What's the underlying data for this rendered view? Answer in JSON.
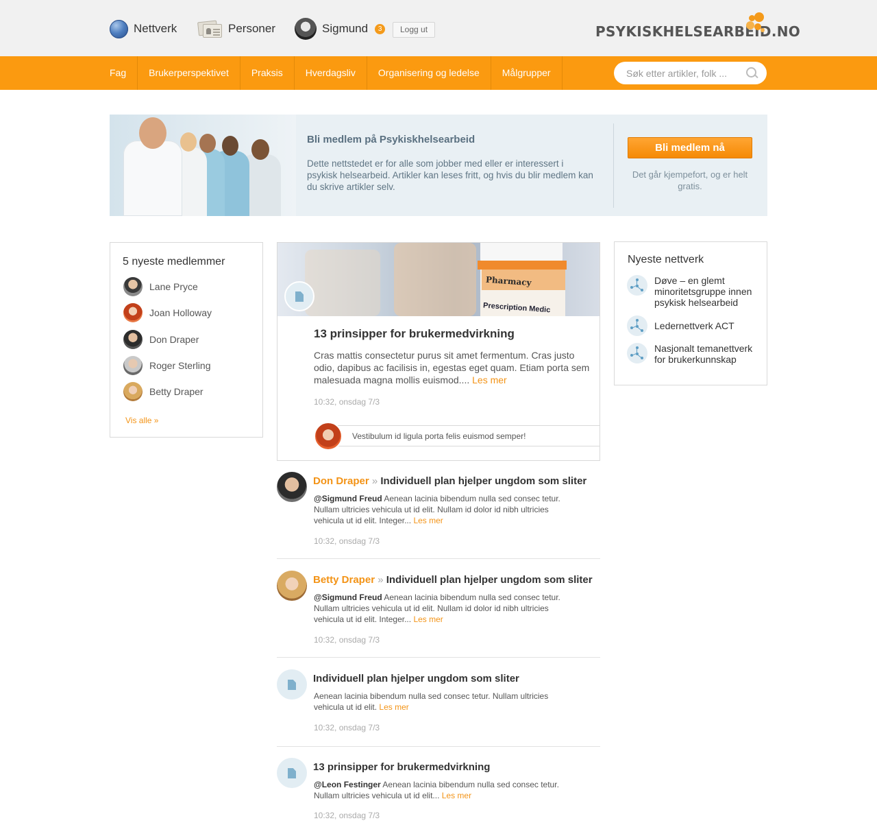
{
  "topbar": {
    "nav": [
      {
        "label": "Nettverk",
        "icon": "globe-icon"
      },
      {
        "label": "Personer",
        "icon": "id-cards-icon"
      }
    ],
    "user": {
      "name": "Sigmund",
      "notifications": "3"
    },
    "logout_label": "Logg ut",
    "logo_text": "PSYKISKHELSEARBEID.NO"
  },
  "navbar": {
    "items": [
      "Fag",
      "Brukerperspektivet",
      "Praksis",
      "Hverdagsliv",
      "Organisering og ledelse",
      "Målgrupper"
    ],
    "search_placeholder": "Søk etter artikler, folk ..."
  },
  "banner": {
    "title": "Bli medlem på Psykiskhelsearbeid",
    "text": "Dette nettstedet er for alle som jobber med eller er interessert i psykisk helsearbeid. Artikler kan leses fritt, og hvis du blir medlem kan du skrive artikler selv.",
    "button": "Bli medlem nå",
    "subtext": "Det går kjempefort, og er helt gratis."
  },
  "members": {
    "title": "5 nyeste medlemmer",
    "items": [
      "Lane Pryce",
      "Joan Holloway",
      "Don Draper",
      "Roger Sterling",
      "Betty Draper"
    ],
    "see_all": "Vis alle »"
  },
  "featured": {
    "image_text": [
      "Pharmacy",
      "Prescription Medic"
    ],
    "title": "13 prinsipper for brukermedvirkning",
    "text": "Cras mattis consectetur purus sit amet fermentum. Cras justo odio, dapibus ac facilisis in, egestas eget quam. Etiam porta sem malesuada magna mollis euismod....",
    "read_more": "Les mer",
    "time": "10:32, onsdag 7/3",
    "comment": "Vestibulum id ligula porta felis euismod semper!"
  },
  "feed": [
    {
      "author": "Don Draper",
      "separator": "»",
      "title": "Individuell plan hjelper ungdom som sliter",
      "mention": "@Sigmund Freud",
      "text": "Aenean lacinia bibendum nulla sed consec tetur. Nullam ultricies vehicula ut id elit. Nullam id dolor id nibh ultricies vehicula ut id elit. Integer...",
      "read_more": "Les mer",
      "time": "10:32, onsdag 7/3"
    },
    {
      "author": "Betty Draper",
      "separator": "»",
      "title": "Individuell plan hjelper ungdom som sliter",
      "mention": "@Sigmund Freud",
      "text": "Aenean lacinia bibendum nulla sed consec tetur. Nullam ultricies vehicula ut id elit. Nullam id dolor id nibh ultricies vehicula ut id elit. Integer...",
      "read_more": "Les mer",
      "time": "10:32, onsdag 7/3"
    },
    {
      "title": "Individuell plan hjelper ungdom som sliter",
      "text": "Aenean lacinia bibendum nulla sed consec tetur. Nullam ultricies vehicula ut id elit.",
      "read_more": "Les mer",
      "time": "10:32, onsdag 7/3"
    },
    {
      "title": "13 prinsipper for brukermedvirkning",
      "mention": "@Leon Festinger",
      "text": "Aenean lacinia bibendum nulla sed consec tetur. Nullam ultricies vehicula ut id elit...",
      "read_more": "Les mer",
      "time": "10:32, onsdag 7/3"
    }
  ],
  "networks": {
    "title": "Nyeste nettverk",
    "items": [
      "Døve – en glemt minoritetsgruppe innen psykisk helsearbeid",
      "Ledernettverk ACT",
      "Nasjonalt temanettverk for brukerkunnskap"
    ]
  },
  "colors": {
    "accent": "#fb9a10",
    "link": "#f39316",
    "banner_bg": "#e9f0f4"
  }
}
